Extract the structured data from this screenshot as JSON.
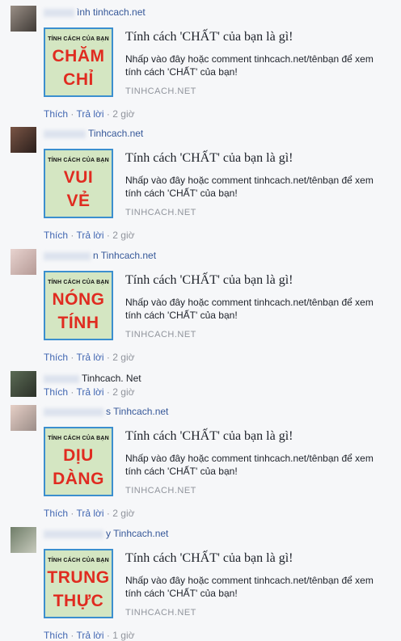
{
  "common": {
    "card_title": "Tính cách 'CHẤT' của bạn là gì!",
    "card_description": "Nhấp vào đây hoặc comment tinhcach.net/tênbạn để xem tính cách 'CHẤT' của bạn!",
    "card_domain": "TINHCACH.NET",
    "thumb_header": "TÍNH CÁCH CỦA BẠN",
    "like_label": "Thích",
    "reply_label": "Trả lời",
    "separator": "·"
  },
  "comments": [
    {
      "name_text": "ình tinhcach.net",
      "word1": "CHĂM",
      "word2": "CHỈ",
      "time": "2 giờ"
    },
    {
      "name_text": "Tinhcach.net",
      "word1": "VUI",
      "word2": "VẺ",
      "time": "2 giờ"
    },
    {
      "name_text": "n Tinhcach.net",
      "word1": "NÓNG",
      "word2": "TÍNH",
      "time": "2 giờ"
    },
    {
      "name_text": "Tinhcach. Net",
      "time": "2 giờ"
    },
    {
      "name_text": "s Tinhcach.net",
      "word1": "DỊU",
      "word2": "DÀNG",
      "time": "2 giờ"
    },
    {
      "name_text": "y Tinhcach.net",
      "word1": "TRUNG",
      "word2": "THỰC",
      "time": "1 giờ"
    }
  ]
}
